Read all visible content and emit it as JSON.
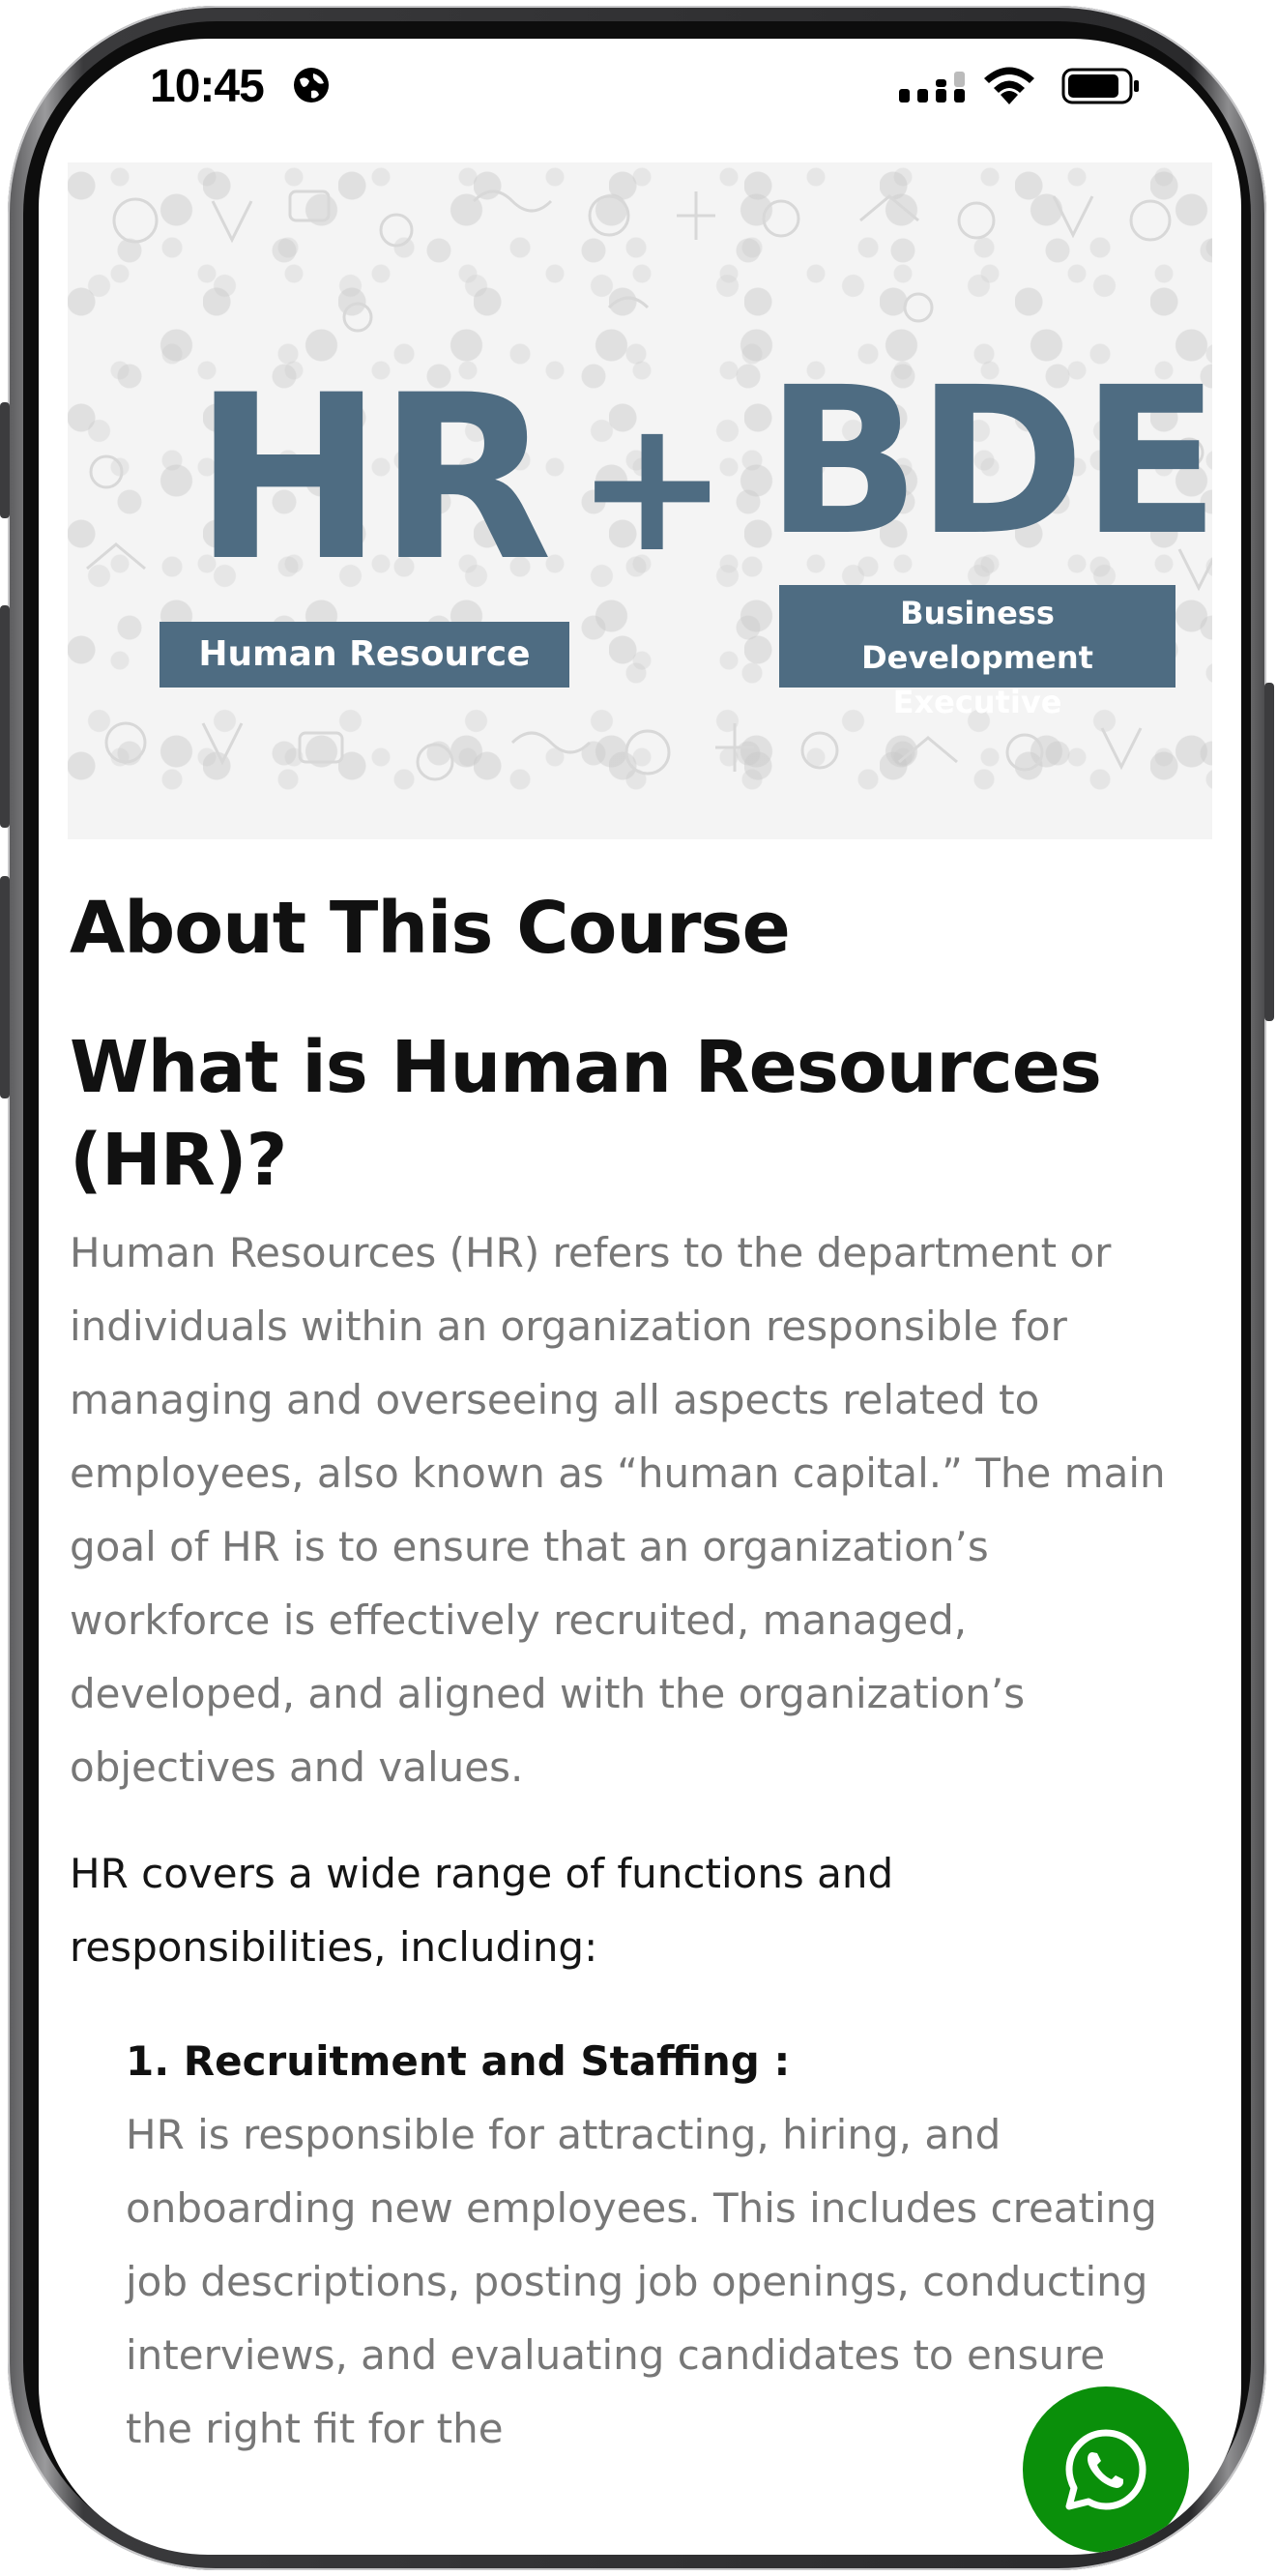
{
  "status_bar": {
    "time": "10:45"
  },
  "hero": {
    "hr_text": "HR",
    "plus_text": "+",
    "bde_text": "BDE",
    "hr_label": "Human Resource",
    "bde_label_line1": "Business",
    "bde_label_line2": "Development Executive",
    "brand_color": "#4e6c82"
  },
  "content": {
    "heading_about": "About This Course",
    "heading_what": "What is Human Resources (HR)?",
    "intro_paragraph": "Human Resources (HR) refers to the department or individuals within an organization responsible for managing and overseeing all aspects related to employees, also known as “human capital.” The main goal of HR is to ensure that an organization’s workforce is effectively recruited, managed, developed, and aligned with the organization’s objectives and values.",
    "covers_paragraph": "HR covers a wide range of functions and responsibilities, including:",
    "list": [
      {
        "title": "1. Recruitment and Staffing :",
        "description": "HR is responsible for attracting, hiring, and onboarding new employees. This includes creating job descriptions, posting job openings, conducting interviews, and evaluating candidates to ensure the right fit for the"
      }
    ]
  },
  "fab": {
    "icon": "whatsapp-icon",
    "color": "#0a8f0a"
  }
}
